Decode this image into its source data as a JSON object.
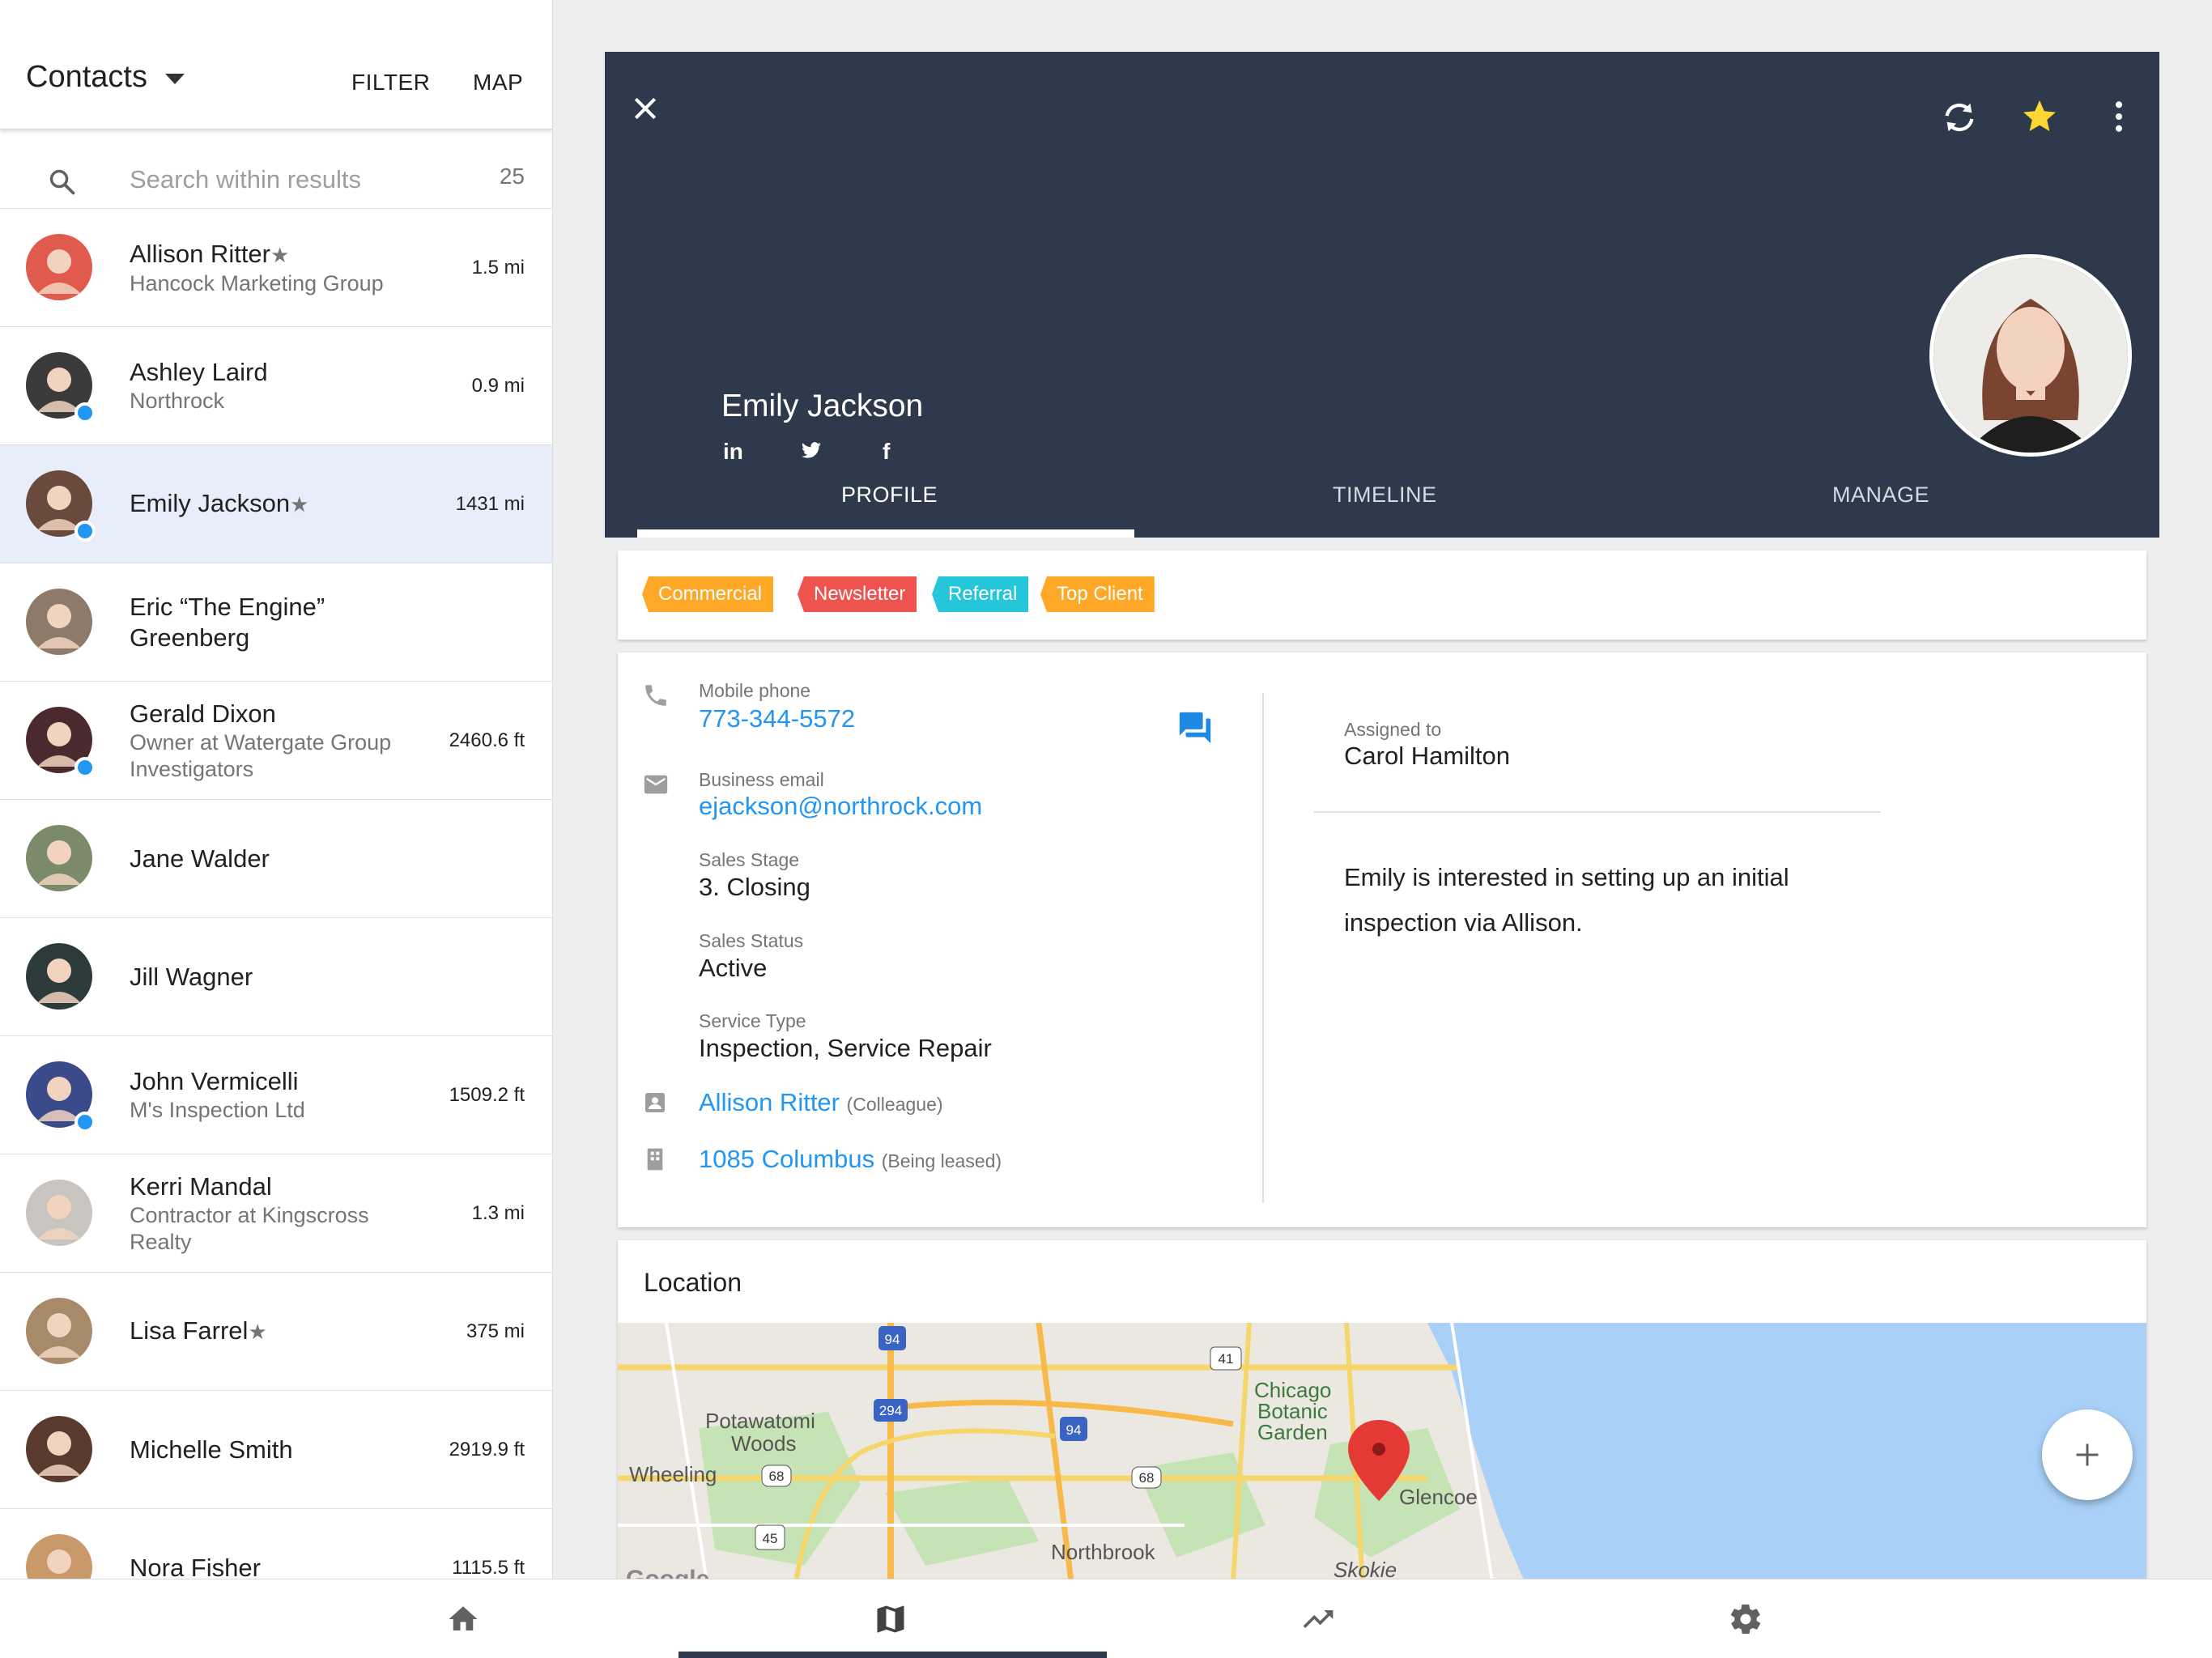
{
  "left_panel": {
    "title": "Contacts",
    "filter_label": "FILTER",
    "map_label": "MAP",
    "search_placeholder": "Search within results",
    "result_count": "25"
  },
  "contacts": [
    {
      "name": "Allison Ritter",
      "starred": true,
      "subtitle": "Hancock Marketing Group",
      "distance": "1.5 mi",
      "online": false,
      "avatar_color": "#e05a4e"
    },
    {
      "name": "Ashley Laird",
      "starred": false,
      "subtitle": "Northrock",
      "distance": "0.9 mi",
      "online": true,
      "avatar_color": "#3a3a3a"
    },
    {
      "name": "Emily Jackson",
      "starred": true,
      "subtitle": "",
      "distance": "1431 mi",
      "online": true,
      "avatar_color": "#6b4a3e"
    },
    {
      "name": "Eric “The Engine” Greenberg",
      "starred": false,
      "subtitle": "",
      "distance": "",
      "online": false,
      "avatar_color": "#8d7a6b"
    },
    {
      "name": "Gerald Dixon",
      "starred": false,
      "subtitle": "Owner at Watergate Group Investigators",
      "distance": "2460.6 ft",
      "online": true,
      "avatar_color": "#4a2a2e"
    },
    {
      "name": "Jane Walder",
      "starred": false,
      "subtitle": "",
      "distance": "",
      "online": false,
      "avatar_color": "#7a8a6a"
    },
    {
      "name": "Jill Wagner",
      "starred": false,
      "subtitle": "",
      "distance": "",
      "online": false,
      "avatar_color": "#2c3a3a"
    },
    {
      "name": "John Vermicelli",
      "starred": false,
      "subtitle": "M's Inspection Ltd",
      "distance": "1509.2 ft",
      "online": true,
      "avatar_color": "#3a4a8a"
    },
    {
      "name": "Kerri Mandal",
      "starred": false,
      "subtitle": "Contractor at Kingscross Realty",
      "distance": "1.3 mi",
      "online": false,
      "avatar_color": "#c8c4c0"
    },
    {
      "name": "Lisa Farrel",
      "starred": true,
      "subtitle": "",
      "distance": "375 mi",
      "online": false,
      "avatar_color": "#a88a6a"
    },
    {
      "name": "Michelle Smith",
      "starred": false,
      "subtitle": "",
      "distance": "2919.9 ft",
      "online": false,
      "avatar_color": "#5a3a2e"
    },
    {
      "name": "Nora Fisher",
      "starred": false,
      "subtitle": "",
      "distance": "1115.5 ft",
      "online": false,
      "avatar_color": "#c89a6a"
    }
  ],
  "selected_contact_index": 2,
  "bottom_nav": {
    "items": [
      "home-icon",
      "map-icon",
      "trending-icon",
      "settings-icon"
    ],
    "active": "map-icon"
  },
  "detail": {
    "name": "Emily Jackson",
    "social": [
      "in",
      "twitter-icon",
      "f"
    ],
    "tabs": [
      "PROFILE",
      "TIMELINE",
      "MANAGE"
    ],
    "active_tab": "PROFILE",
    "favorite": true,
    "header_bg": "#2e3a4b",
    "tags": [
      {
        "label": "Commercial",
        "color": "#ffa726"
      },
      {
        "label": "Newsletter",
        "color": "#ef5350"
      },
      {
        "label": "Referral",
        "color": "#26c6da"
      },
      {
        "label": "Top Client",
        "color": "#ffa726"
      }
    ],
    "fields": {
      "mobile_label": "Mobile phone",
      "mobile_value": "773-344-5572",
      "email_label": "Business email",
      "email_value": "ejackson@northrock.com",
      "stage_label": "Sales Stage",
      "stage_value": "3. Closing",
      "status_label": "Sales Status",
      "status_value": "Active",
      "service_label": "Service Type",
      "service_value": "Inspection, Service Repair",
      "colleague_name": "Allison Ritter",
      "colleague_role": "(Colleague)",
      "property_name": "1085 Columbus",
      "property_status": "(Being leased)"
    },
    "assigned_label": "Assigned to",
    "assigned_value": "Carol Hamilton",
    "note": "Emily is interested in setting up an initial inspection via Allison.",
    "location_title": "Location",
    "map_labels": [
      "Potawatomi",
      "Woods",
      "Wheeling",
      "Chicago",
      "Botanic",
      "Garden",
      "Glencoe",
      "Northbrook",
      "Skokie"
    ],
    "map_shields": [
      "94",
      "294",
      "94",
      "41",
      "68",
      "68",
      "45"
    ],
    "map_attribution": "Google",
    "accent": "#2196f3"
  }
}
